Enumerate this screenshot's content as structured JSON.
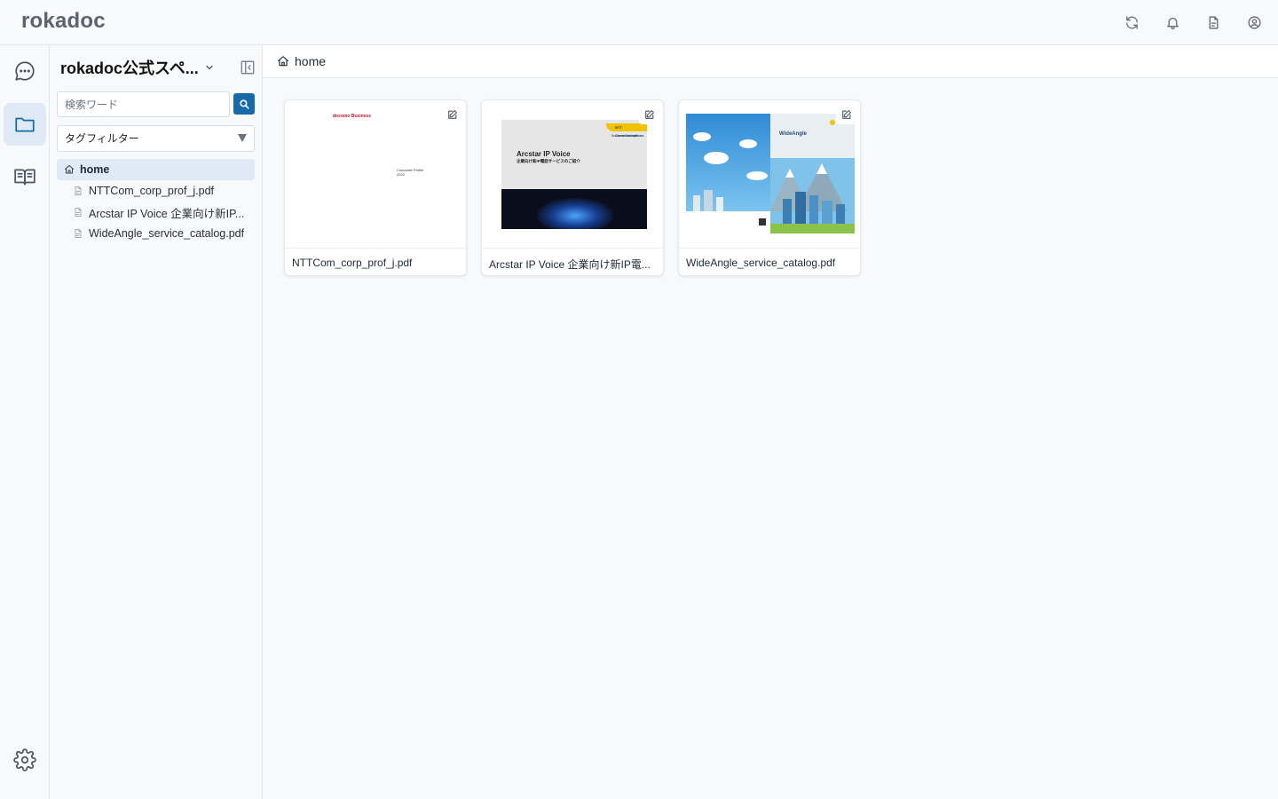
{
  "app": {
    "logo": "rokadoc"
  },
  "sidebar": {
    "space_name": "rokadoc公式スペ...",
    "search_placeholder": "検索ワード",
    "tag_filter_label": "タグフィルター",
    "tree": {
      "home_label": "home",
      "files": [
        "NTTCom_corp_prof_j.pdf",
        "Arcstar IP Voice 企業向け新IP...",
        "WideAngle_service_catalog.pdf"
      ]
    }
  },
  "main": {
    "breadcrumb": "home",
    "cards": [
      {
        "name": "NTTCom_corp_prof_j.pdf",
        "thumb_brand": "docomo Business",
        "thumb_subtitle_1": "Corporate Profile",
        "thumb_subtitle_2": "2022"
      },
      {
        "name": "Arcstar IP Voice 企業向け新IP電...",
        "thumb_title": "Arcstar IP Voice",
        "thumb_subtitle": "企業向け新IP電話サービスのご紹介",
        "thumb_logo": "NTT Communications",
        "thumb_small": "Business Strategist"
      },
      {
        "name": "WideAngle_service_catalog.pdf",
        "thumb_title": "WideAngle"
      }
    ]
  },
  "colors": {
    "accent": "#1769aa",
    "active_bg": "#dfeaf6",
    "background": "#f7f9fb",
    "border": "#e3e7ec"
  },
  "icons": {
    "top": [
      "refresh-icon",
      "bell-icon",
      "document-icon",
      "user-circle-icon"
    ],
    "rail": [
      "chat-icon",
      "folder-icon",
      "book-icon",
      "gear-icon"
    ]
  }
}
